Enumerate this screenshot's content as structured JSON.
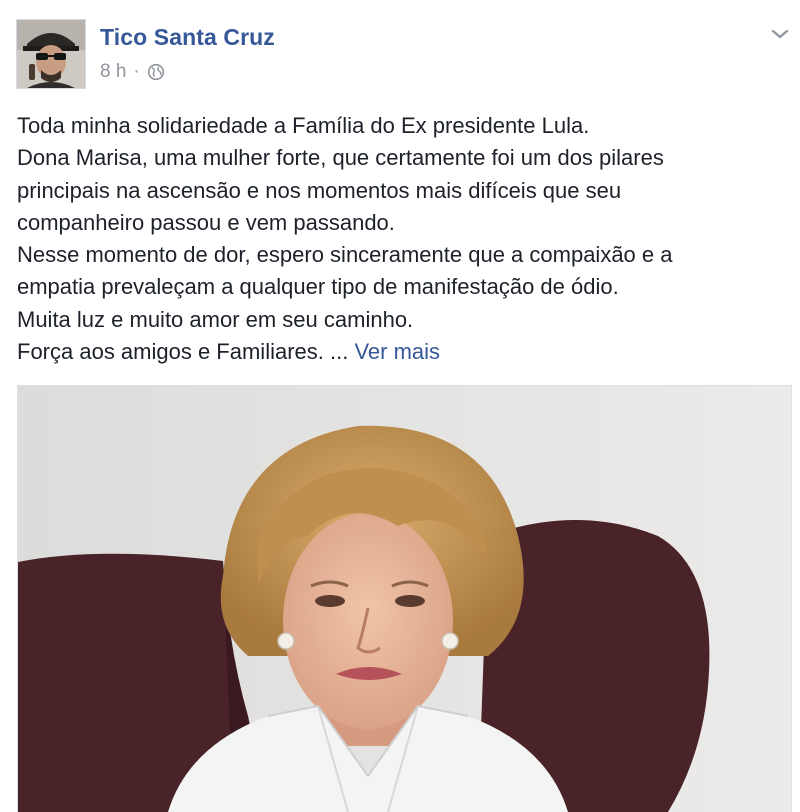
{
  "post": {
    "author": "Tico Santa Cruz",
    "timestamp": "8 h",
    "separator": "·",
    "privacy_icon": "globe-icon",
    "menu_icon": "chevron-down-icon",
    "body_lines": [
      "Toda minha solidariedade a Família do Ex presidente Lula.",
      "Dona Marisa, uma mulher forte, que certamente foi um dos pilares",
      "principais na ascensão e nos momentos mais difíceis que seu",
      "companheiro passou e vem passando.",
      "Nesse momento de dor, espero sinceramente que a compaixão e a",
      "empatia prevaleçam a qualquer tipo de manifestação de ódio.",
      "Muita luz e muito amor em seu caminho.",
      "Força aos amigos e Familiares. ..."
    ],
    "see_more": "Ver mais"
  },
  "colors": {
    "link": "#365899",
    "meta": "#90949c",
    "text": "#1d2129",
    "chair": "#4a2329",
    "photo_bg": "#e3e3e1"
  }
}
